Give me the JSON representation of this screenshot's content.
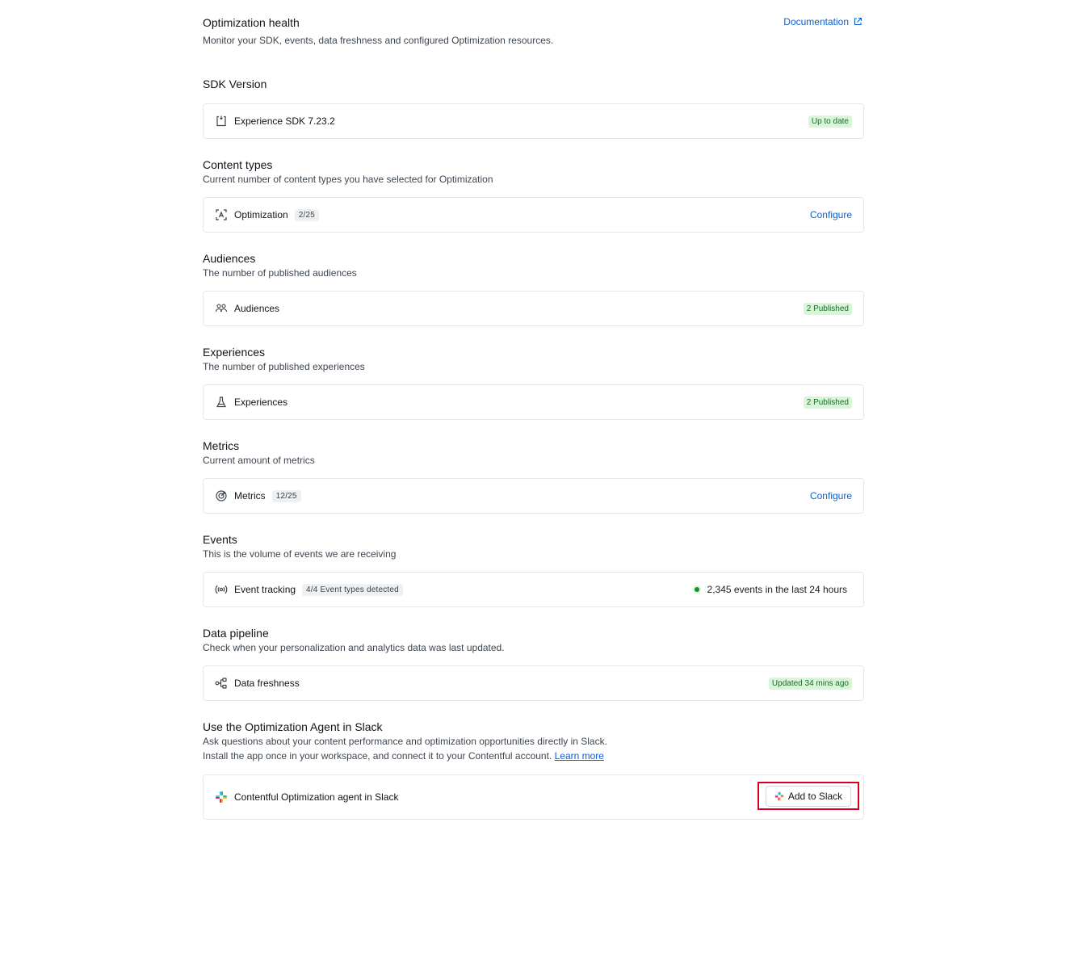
{
  "header": {
    "title": "Optimization health",
    "subtitle": "Monitor your SDK, events, data freshness and configured Optimization resources.",
    "documentation_label": "Documentation"
  },
  "sdk": {
    "title": "SDK Version",
    "label": "Experience SDK 7.23.2",
    "status": "Up to date"
  },
  "content_types": {
    "title": "Content types",
    "description": "Current number of content types you have selected for Optimization",
    "label": "Optimization",
    "count": "2/25",
    "action": "Configure"
  },
  "audiences": {
    "title": "Audiences",
    "description": "The number of published audiences",
    "label": "Audiences",
    "status": "2 Published"
  },
  "experiences": {
    "title": "Experiences",
    "description": "The number of published experiences",
    "label": "Experiences",
    "status": "2 Published"
  },
  "metrics": {
    "title": "Metrics",
    "description": "Current amount of metrics",
    "label": "Metrics",
    "count": "12/25",
    "action": "Configure"
  },
  "events": {
    "title": "Events",
    "description": "This is the volume of events we are receiving",
    "label": "Event tracking",
    "count": "4/4 Event types detected",
    "volume": "2,345 events in the last 24 hours"
  },
  "pipeline": {
    "title": "Data pipeline",
    "description": "Check when your personalization and analytics data was last updated.",
    "label": "Data freshness",
    "status": "Updated 34 mins ago"
  },
  "slack": {
    "title": "Use the Optimization Agent in Slack",
    "description_line1": "Ask questions about your content performance and optimization opportunities directly in Slack.",
    "description_line2": "Install the app once in your workspace, and connect it to your Contentful account.",
    "learn_more": "Learn more",
    "label": "Contentful Optimization agent in Slack",
    "button_label": "Add to Slack"
  },
  "colors": {
    "link": "#0b5fd3",
    "success_bg": "#d8f5d8",
    "success_text": "#1d6b2a",
    "highlight": "#d6001c"
  }
}
